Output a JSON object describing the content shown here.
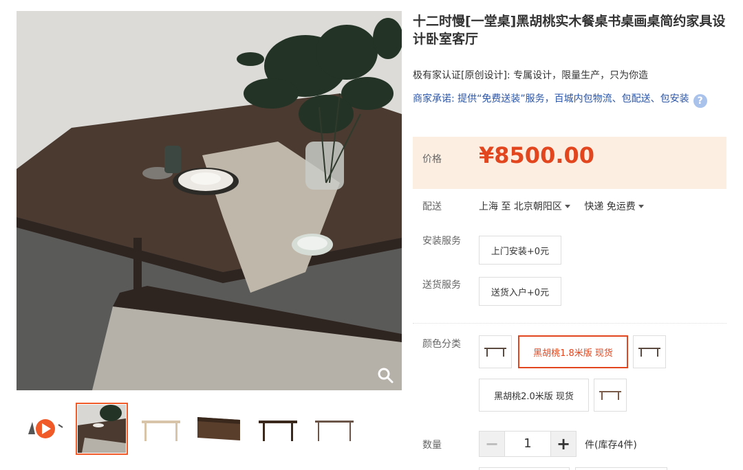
{
  "product": {
    "title": "十二时慢[一堂桌]黑胡桃实木餐桌书桌画桌简约家具设计卧室客厅",
    "subtitle": "极有家认证[原创设计]: 专属设计，限量生产，只为你造",
    "promise": "商家承诺: 提供“免费送装”服务，百城内包物流、包配送、包安装",
    "help_icon": "?"
  },
  "price": {
    "label": "价格",
    "value": "¥8500.00"
  },
  "shipping": {
    "label": "配送",
    "from": "上海 至",
    "to": "北京朝阳区",
    "method": "快递 免运费"
  },
  "install_service": {
    "label": "安装服务",
    "option": "上门安装+0元"
  },
  "delivery_service": {
    "label": "送货服务",
    "option": "送货入户+0元"
  },
  "color": {
    "label": "颜色分类",
    "options": [
      "黑胡桃1.8米版 现货",
      "黑胡桃2.0米版 现货"
    ],
    "selected": "黑胡桃1.8米版 现货"
  },
  "quantity": {
    "label": "数量",
    "minus": "−",
    "value": "1",
    "plus": "+",
    "stock": "件(库存4件)"
  },
  "icons": {
    "zoom": "magnifier-icon",
    "video": "play-video-icon",
    "help": "question-circle-icon"
  },
  "colors": {
    "accent": "#e2461f",
    "price_bg": "#fdeee2",
    "link": "#2a55a8",
    "selected_border": "#f05a28"
  }
}
